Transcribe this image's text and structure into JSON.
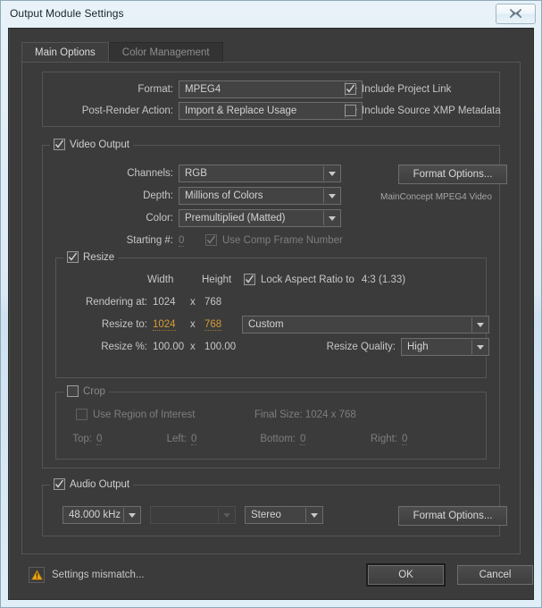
{
  "window": {
    "title": "Output Module Settings",
    "close_glyph": "✖"
  },
  "tabs": [
    {
      "label": "Main Options",
      "active": true
    },
    {
      "label": "Color Management",
      "active": false
    }
  ],
  "format_group": {
    "format_label": "Format:",
    "format_value": "MPEG4",
    "post_render_label": "Post-Render Action:",
    "post_render_value": "Import & Replace Usage",
    "include_project_link_label": "Include Project Link",
    "include_project_link_checked": true,
    "include_xmp_label": "Include Source XMP Metadata",
    "include_xmp_checked": false
  },
  "video_output": {
    "legend": "Video Output",
    "checked": true,
    "channels_label": "Channels:",
    "channels_value": "RGB",
    "depth_label": "Depth:",
    "depth_value": "Millions of Colors",
    "color_label": "Color:",
    "color_value": "Premultiplied (Matted)",
    "starting_label": "Starting #:",
    "starting_value": "0",
    "use_comp_frame_label": "Use Comp Frame Number",
    "use_comp_frame_checked": true,
    "format_options_label": "Format Options...",
    "codec_note": "MainConcept MPEG4 Video"
  },
  "resize": {
    "legend": "Resize",
    "checked": true,
    "width_header": "Width",
    "height_header": "Height",
    "lock_aspect_label": "Lock Aspect Ratio to",
    "lock_aspect_value": "4:3 (1.33)",
    "lock_aspect_checked": true,
    "rendering_at_label": "Rendering at:",
    "rendering_at_width": "1024",
    "rendering_at_x": "x",
    "rendering_at_height": "768",
    "resize_to_label": "Resize to:",
    "resize_to_width": "1024",
    "resize_to_x": "x",
    "resize_to_height": "768",
    "preset_value": "Custom",
    "resize_pct_label": "Resize %:",
    "resize_pct_width": "100.00",
    "resize_pct_x": "x",
    "resize_pct_height": "100.00",
    "quality_label": "Resize Quality:",
    "quality_value": "High"
  },
  "crop": {
    "legend": "Crop",
    "checked": false,
    "use_roi_label": "Use Region of Interest",
    "use_roi_checked": false,
    "final_size_label": "Final Size: 1024 x 768",
    "top_label": "Top:",
    "top_value": "0",
    "left_label": "Left:",
    "left_value": "0",
    "bottom_label": "Bottom:",
    "bottom_value": "0",
    "right_label": "Right:",
    "right_value": "0"
  },
  "audio_output": {
    "legend": "Audio Output",
    "checked": true,
    "rate_value": "48.000 kHz",
    "bitdepth_value": "",
    "channels_value": "Stereo",
    "format_options_label": "Format Options..."
  },
  "footer": {
    "warning_text": "Settings mismatch...",
    "warning_icon": "warning-triangle-icon",
    "ok_label": "OK",
    "cancel_label": "Cancel"
  },
  "colors": {
    "accent_link": "#d59b36",
    "panel_bg": "#3b3b3b",
    "warning": "#e8a317"
  }
}
